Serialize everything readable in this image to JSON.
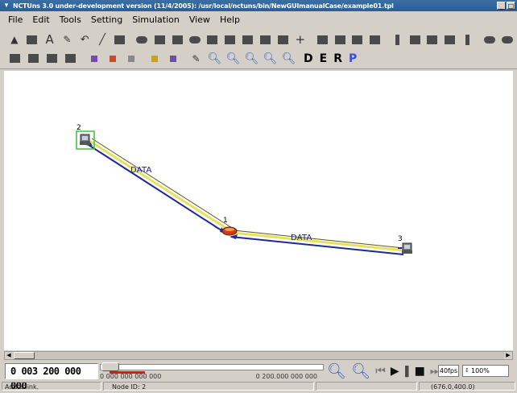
{
  "window": {
    "title": "NCTUns 3.0 under-development version (11/4/2005): /usr/local/nctuns/bin/NewGUImanualCase/example01.tpl",
    "minimize_label": "_",
    "maximize_label": "□"
  },
  "menu": [
    "File",
    "Edit",
    "Tools",
    "Setting",
    "Simulation",
    "View",
    "Help"
  ],
  "toolbar2_letters": [
    "D",
    "E",
    "R",
    "P"
  ],
  "topology": {
    "nodes": [
      {
        "id": "2",
        "kind": "host"
      },
      {
        "id": "1",
        "kind": "router"
      },
      {
        "id": "3",
        "kind": "host"
      }
    ],
    "links": [
      {
        "from": "1",
        "to": "2",
        "label": "DATA"
      },
      {
        "from": "1",
        "to": "3",
        "label": "DATA"
      }
    ]
  },
  "control": {
    "clock": "0 003 200 000 000",
    "timeline_start": "0 000 000 000 000",
    "timeline_end": "0 200.000 000 000",
    "progress_fraction": 0.16,
    "speed": "40fps",
    "zoom": "100%"
  },
  "status": {
    "message": "Add a link.",
    "node_id": "Node ID: 2",
    "coordinates": "(676.0,400.0)"
  },
  "colors": {
    "title_bar": "#2d5d93",
    "link_line": "#1e2a9a",
    "link_highlight": "#e8e060",
    "selection": "#39c439",
    "router": "#d23a1c"
  }
}
